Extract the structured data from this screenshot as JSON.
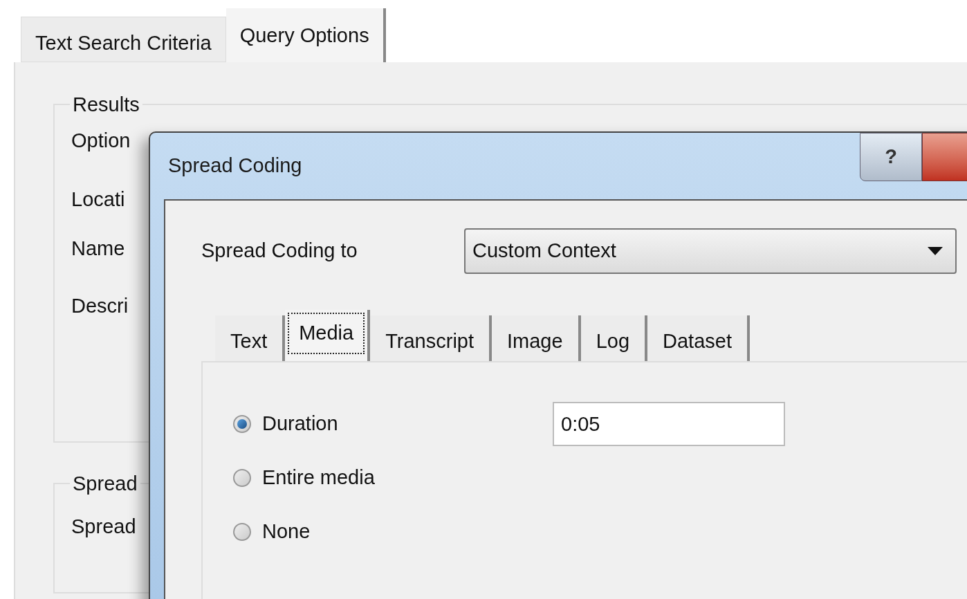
{
  "back_tabs": [
    {
      "label": "Text Search Criteria",
      "selected": false
    },
    {
      "label": "Query Options",
      "selected": true
    }
  ],
  "results_group": {
    "title": "Results",
    "labels": [
      "Option",
      "Locati",
      "Name",
      "Descri"
    ]
  },
  "spread_group": {
    "title": "Spread",
    "labels": [
      "Spread"
    ]
  },
  "dialog": {
    "title": "Spread Coding",
    "help": "?",
    "spread_label": "Spread Coding to",
    "spread_value": "Custom Context",
    "tabs": [
      {
        "label": "Text",
        "selected": false
      },
      {
        "label": "Media",
        "selected": true
      },
      {
        "label": "Transcript",
        "selected": false
      },
      {
        "label": "Image",
        "selected": false
      },
      {
        "label": "Log",
        "selected": false
      },
      {
        "label": "Dataset",
        "selected": false
      }
    ],
    "options": [
      {
        "label": "Duration",
        "selected": true,
        "value": "0:05"
      },
      {
        "label": "Entire media",
        "selected": false
      },
      {
        "label": "None",
        "selected": false
      }
    ]
  }
}
